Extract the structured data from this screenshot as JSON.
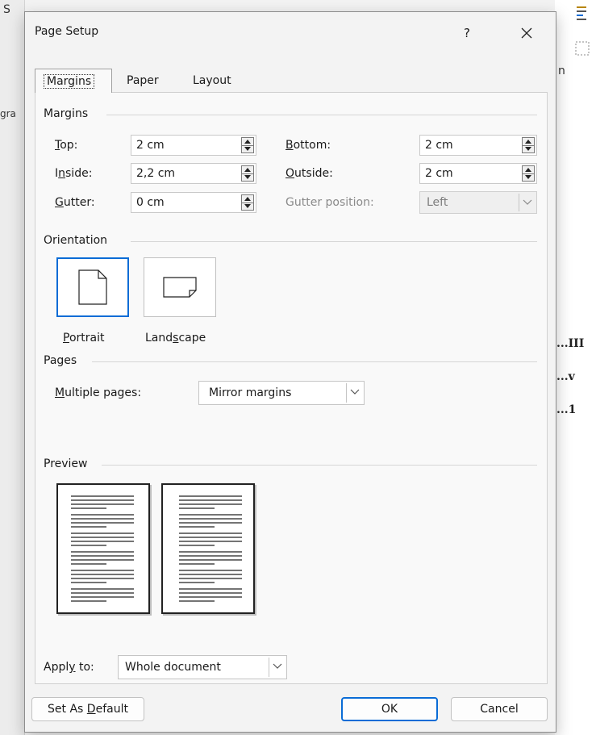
{
  "dialog": {
    "title": "Page Setup",
    "help_label": "?",
    "close_label": "✕"
  },
  "tabs": [
    {
      "label": "Margins",
      "active": true
    },
    {
      "label": "Paper",
      "active": false
    },
    {
      "label": "Layout",
      "active": false
    }
  ],
  "margins": {
    "section_label": "Margins",
    "top": {
      "label_access": "T",
      "label_rest": "op:",
      "value": "2 cm"
    },
    "bottom": {
      "label_access": "B",
      "label_rest": "ottom:",
      "value": "2 cm"
    },
    "inside": {
      "label_pre": "I",
      "label_access": "n",
      "label_rest": "side:",
      "value": "2,2 cm"
    },
    "outside": {
      "label_access": "O",
      "label_rest": "utside:",
      "value": "2 cm"
    },
    "gutter": {
      "label_access": "G",
      "label_rest": "utter:",
      "value": "0 cm"
    },
    "gutter_position": {
      "label": "Gutter position:",
      "value": "Left",
      "disabled": true
    }
  },
  "orientation": {
    "section_label": "Orientation",
    "portrait": {
      "label_access": "P",
      "label_rest": "ortrait",
      "selected": true
    },
    "landscape": {
      "label_pre": "Land",
      "label_access": "s",
      "label_rest": "cape",
      "selected": false
    }
  },
  "pages": {
    "section_label": "Pages",
    "multiple_pages": {
      "label_access": "M",
      "label_rest": "ultiple pages:",
      "value": "Mirror margins"
    }
  },
  "preview": {
    "section_label": "Preview"
  },
  "apply_to": {
    "label_pre": "Appl",
    "label_access": "y",
    "label_rest": " to:",
    "value": "Whole document"
  },
  "buttons": {
    "set_default": {
      "label_pre": "Set As ",
      "label_access": "D",
      "label_rest": "efault"
    },
    "ok": "OK",
    "cancel": "Cancel"
  },
  "background": {
    "fragments": [
      "S",
      "gra",
      "n",
      "...III",
      "...v",
      "...1"
    ]
  },
  "colors": {
    "accent": "#0a6cd6",
    "dialog_bg": "#f3f3f3",
    "panel_bg": "#f9f9f9"
  }
}
